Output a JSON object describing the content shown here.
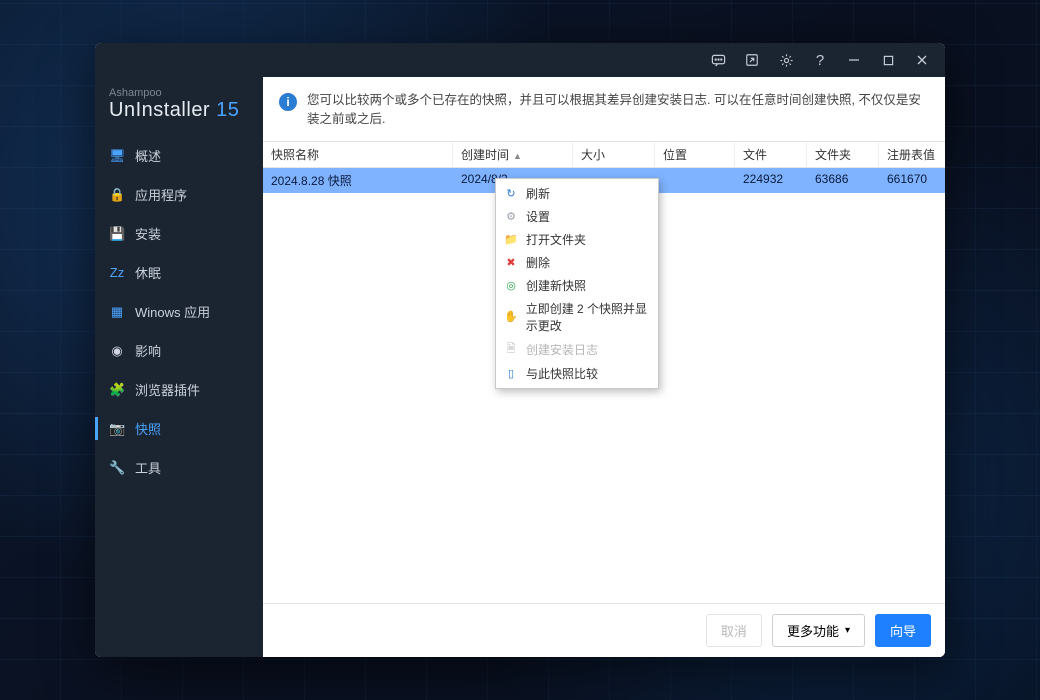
{
  "brand": {
    "line1": "Ashampoo",
    "name": "UnInstaller",
    "version": "15"
  },
  "titlebar": {
    "icons": [
      "feedback",
      "share",
      "settings",
      "help",
      "minimize",
      "maximize",
      "close"
    ]
  },
  "sidebar": {
    "items": [
      {
        "icon": "🖥",
        "label": "概述",
        "color": "#4aa3ff"
      },
      {
        "icon": "🔒",
        "label": "应用程序",
        "color": "#f4a030"
      },
      {
        "icon": "💾",
        "label": "安装",
        "color": "#cfd6e1"
      },
      {
        "icon": "Zz",
        "label": "休眠",
        "color": "#4aa3ff"
      },
      {
        "icon": "▦",
        "label": "Winows 应用",
        "color": "#4aa3ff"
      },
      {
        "icon": "◉",
        "label": "影响",
        "color": "#cfd6e1"
      },
      {
        "icon": "🧩",
        "label": "浏览器插件",
        "color": "#cfd6e1"
      },
      {
        "icon": "📷",
        "label": "快照",
        "color": "#4aa3ff"
      },
      {
        "icon": "🔧",
        "label": "工具",
        "color": "#cfd6e1"
      }
    ],
    "activeIndex": 7
  },
  "info": {
    "text": "您可以比较两个或多个已存在的快照，并且可以根据其差异创建安装日志. 可以在任意时间创建快照, 不仅仅是安装之前或之后."
  },
  "table": {
    "columns": [
      "快照名称",
      "创建时间",
      "大小",
      "位置",
      "文件",
      "文件夹",
      "注册表值"
    ],
    "sortColumn": 1,
    "sortAsc": true,
    "rows": [
      {
        "name": "2024.8.28 快照",
        "created": "2024/8/2",
        "size": "",
        "location": "",
        "files": "224932",
        "folders": "63686",
        "reg": "661670",
        "selected": true
      }
    ]
  },
  "contextMenu": {
    "items": [
      {
        "icon": "↻",
        "iconColor": "#2b7cd3",
        "label": "刷新",
        "disabled": false
      },
      {
        "icon": "⚙",
        "iconColor": "#9aa1ab",
        "label": "设置",
        "disabled": false
      },
      {
        "icon": "📁",
        "iconColor": "#f4b400",
        "label": "打开文件夹",
        "disabled": false
      },
      {
        "icon": "✖",
        "iconColor": "#e23b3b",
        "label": "删除",
        "disabled": false
      },
      {
        "icon": "◎",
        "iconColor": "#2aa84a",
        "label": "创建新快照",
        "disabled": false
      },
      {
        "icon": "✋",
        "iconColor": "#f4b400",
        "label": "立即创建 2 个快照并显示更改",
        "disabled": false
      },
      {
        "icon": "🗎",
        "iconColor": "#b6b6b6",
        "label": "创建安装日志",
        "disabled": true
      },
      {
        "icon": "▯",
        "iconColor": "#2b7cd3",
        "label": "与此快照比较",
        "disabled": false
      }
    ]
  },
  "footer": {
    "cancel": "取消",
    "more": "更多功能",
    "wizard": "向导"
  }
}
